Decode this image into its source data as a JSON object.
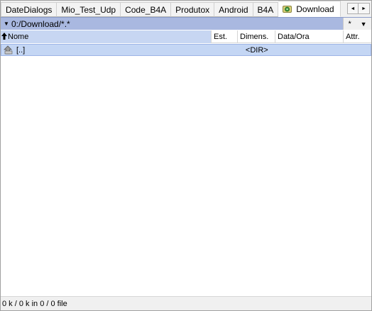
{
  "tabs": [
    {
      "label": "DateDialogs"
    },
    {
      "label": "Mio_Test_Udp"
    },
    {
      "label": "Code_B4A"
    },
    {
      "label": "Produtox"
    },
    {
      "label": "Android"
    },
    {
      "label": "B4A"
    },
    {
      "label": "Download",
      "active": true
    }
  ],
  "tab_scroll": {
    "left": "◄",
    "right": "►"
  },
  "pathbar": {
    "dropdown": "▼",
    "path": "0:/Download/*.*",
    "filter_symbol": "*",
    "history_dropdown": "▼"
  },
  "columns": {
    "name": "Nome",
    "sort_arrow": "🡅",
    "est": "Est.",
    "dim": "Dimens.",
    "date": "Data/Ora",
    "attr": "Attr."
  },
  "rows": [
    {
      "name": "[..]",
      "est": "",
      "dim": "<DIR>",
      "date": "",
      "attr": ""
    }
  ],
  "status": {
    "text": "0 k / 0 k in 0 / 0 file"
  },
  "colors": {
    "path_bar_bg": "#a9b8e0",
    "selected_row": "#c4d6f4",
    "sorted_column_bg": "#c7d6f2"
  },
  "icons": {
    "tab_active": "drive-icon",
    "up_dir": "up-folder-icon"
  }
}
